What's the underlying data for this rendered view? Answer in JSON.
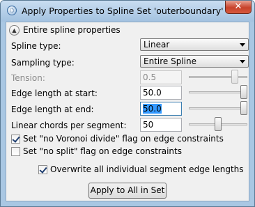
{
  "window": {
    "title": "Apply Properties to Spline Set 'outerboundary'",
    "close_glyph": "✕",
    "icon": "app-globe-icon"
  },
  "section": {
    "label": "Entire spline properties",
    "toggle_glyph": "▲",
    "expanded": true
  },
  "fields": {
    "spline_type": {
      "label": "Spline type:",
      "value": "Linear"
    },
    "sampling_type": {
      "label": "Sampling type:",
      "value": "Entire Spline"
    },
    "tension": {
      "label": "Tension:",
      "value": "0.5",
      "enabled": false,
      "slider_fraction": 0.82
    },
    "edge_length_start": {
      "label": "Edge length at start:",
      "value": "50.0",
      "slider_fraction": 1.0
    },
    "edge_length_end": {
      "label": "Edge length at end:",
      "value": "50.0",
      "focused": true,
      "selected": true,
      "slider_fraction": 1.0
    },
    "linear_chords": {
      "label": "Linear chords per segment:",
      "value": "50",
      "slider_fraction": 0.5
    }
  },
  "checkboxes": {
    "no_voronoi": {
      "label": "Set \"no Voronoi divide\" flag on edge constraints",
      "checked": true
    },
    "no_split": {
      "label": "Set \"no split\" flag on edge constraints",
      "checked": false
    },
    "overwrite": {
      "label": "Overwrite all individual segment edge lengths",
      "checked": true
    }
  },
  "buttons": {
    "apply": "Apply to All in Set"
  },
  "colors": {
    "titlebar": "#a9c7e3",
    "close": "#c7422b",
    "selection": "#3399ff"
  }
}
